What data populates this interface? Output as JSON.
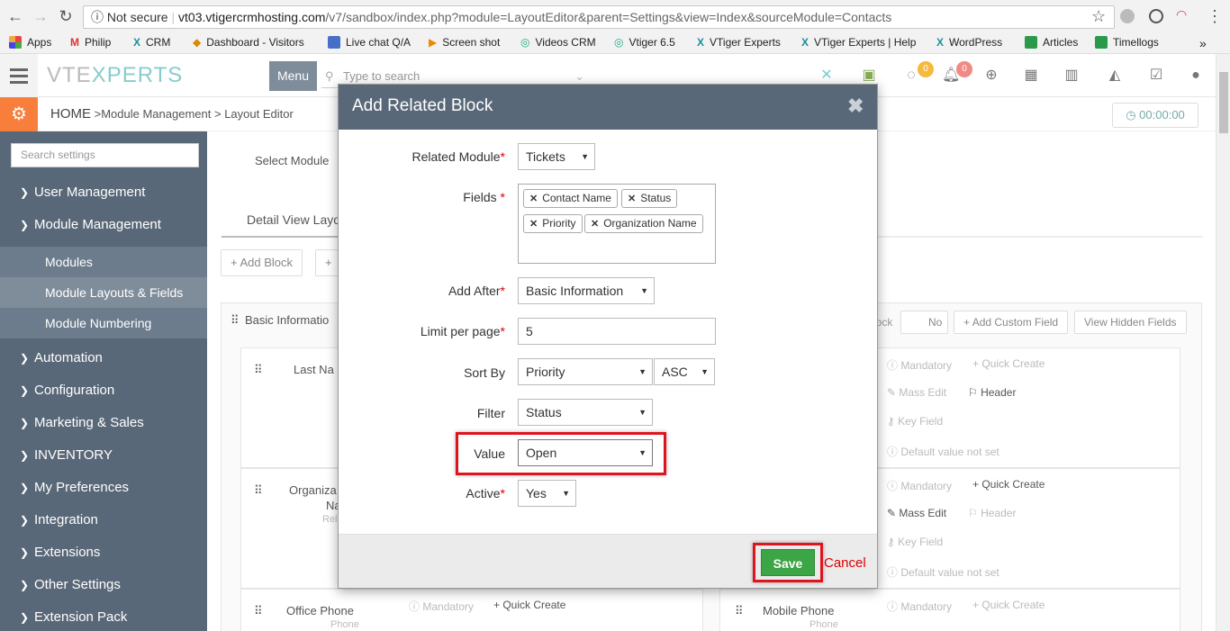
{
  "browser": {
    "security_label": "Not secure",
    "url_host": "vt03.vtigercrmhosting.com",
    "url_path": "/v7/sandbox/index.php?module=LayoutEditor&parent=Settings&view=Index&sourceModule=Contacts",
    "bookmarks": [
      "Apps",
      "Philip",
      "CRM",
      "Dashboard - Visitors",
      "Live chat Q/A",
      "Screen shot",
      "Videos CRM",
      "Vtiger 6.5",
      "VTiger Experts",
      "VTiger Experts | Help",
      "WordPress",
      "Articles",
      "Timellogs"
    ],
    "more_bookmarks": "»"
  },
  "header": {
    "logo_a": "VTE",
    "logo_b": "XPERTS",
    "menu_label": "Menu",
    "search_placeholder": "Type to search",
    "chat_count": "0",
    "notif_count": "0"
  },
  "subheader": {
    "home": "HOME",
    "crumb1": "Module Management",
    "crumb2": "Layout Editor",
    "timer": "00:00:00"
  },
  "sidebar": {
    "search_placeholder": "Search settings",
    "items": [
      "User Management",
      "Module Management",
      "Automation",
      "Configuration",
      "Marketing & Sales",
      "INVENTORY",
      "My Preferences",
      "Integration",
      "Extensions",
      "Other Settings",
      "Extension Pack"
    ],
    "subitems": [
      "Modules",
      "Module Layouts & Fields",
      "Module Numbering"
    ]
  },
  "main": {
    "select_module": "Select Module",
    "tab_detail": "Detail View Layo",
    "add_block": "Add Block",
    "basic_info": "Basic Informatio",
    "block_toggle_label": "lock",
    "no_label": "No",
    "add_custom_field": "Add Custom Field",
    "view_hidden_fields": "View Hidden Fields",
    "last_name": "Last Na",
    "organization": "Organiza",
    "org_line2": "Na",
    "org_line3": "Rel",
    "office_phone": "Office Phone",
    "office_phone_sub": "Phone",
    "mobile_phone": "Mobile Phone",
    "mobile_phone_sub": "Phone",
    "mandatory": "Mandatory",
    "quick_create": "Quick Create",
    "mass_edit": "Mass Edit",
    "header_lbl": "Header",
    "key_field": "Key Field",
    "default_value": "Default value not set"
  },
  "modal": {
    "title": "Add Related Block",
    "related_module_label": "Related Module",
    "related_module_value": "Tickets",
    "fields_label": "Fields",
    "field_tags": [
      "Contact Name",
      "Status",
      "Priority",
      "Organization Name"
    ],
    "add_after_label": "Add After",
    "add_after_value": "Basic Information",
    "limit_label": "Limit per page",
    "limit_value": "5",
    "sort_by_label": "Sort By",
    "sort_by_value": "Priority",
    "sort_dir_value": "ASC",
    "filter_label": "Filter",
    "filter_value": "Status",
    "value_label": "Value",
    "value_value": "Open",
    "active_label": "Active",
    "active_value": "Yes",
    "save_label": "Save",
    "cancel_label": "Cancel",
    "required_mark": "*"
  },
  "colors": {
    "sidebar_bg": "#596878",
    "accent_orange": "#f77f3b",
    "save_green": "#3ca545",
    "highlight_red": "#e0141e"
  }
}
